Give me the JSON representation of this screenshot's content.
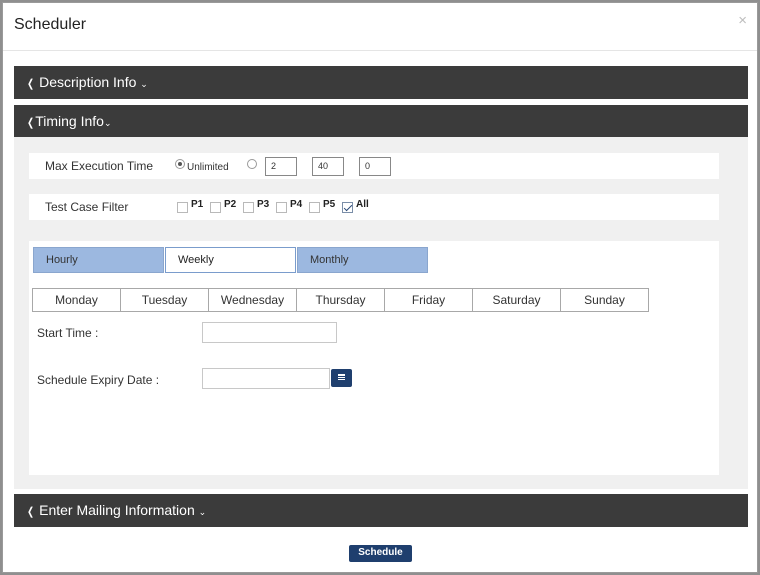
{
  "modal": {
    "title": "Scheduler",
    "close_glyph": "×"
  },
  "sections": {
    "description": {
      "label": "Description Info",
      "left_icon": "chevron-left-icon",
      "right_icon": "chevron-down-icon"
    },
    "timing": {
      "label": "Timing Info",
      "left_icon": "chevron-left-icon",
      "right_icon": "chevron-down-icon"
    },
    "mailing": {
      "label": "Enter Mailing Information",
      "left_icon": "chevron-left-icon",
      "right_icon": "chevron-down-icon"
    }
  },
  "max_execution": {
    "label": "Max Execution Time",
    "unlimited_label": "Unlimited",
    "unlimited_selected": true,
    "custom_selected": false,
    "hours": "2",
    "minutes": "40",
    "seconds": "0"
  },
  "test_case_filter": {
    "label": "Test Case Filter",
    "options": [
      {
        "label": "P1",
        "checked": false
      },
      {
        "label": "P2",
        "checked": false
      },
      {
        "label": "P3",
        "checked": false
      },
      {
        "label": "P4",
        "checked": false
      },
      {
        "label": "P5",
        "checked": false
      },
      {
        "label": "All",
        "checked": true
      }
    ]
  },
  "frequency_tabs": [
    {
      "label": "Hourly",
      "active": false
    },
    {
      "label": "Weekly",
      "active": true
    },
    {
      "label": "Monthly",
      "active": false
    }
  ],
  "days": [
    "Monday",
    "Tuesday",
    "Wednesday",
    "Thursday",
    "Friday",
    "Saturday",
    "Sunday"
  ],
  "start_time": {
    "label": "Start Time :",
    "value": ""
  },
  "expiry_date": {
    "label": "Schedule Expiry Date :",
    "value": "",
    "icon": "calendar-icon"
  },
  "footer": {
    "schedule_label": "Schedule"
  },
  "colors": {
    "section_bar": "#3b3b3b",
    "accent": "#1f3f6e",
    "tab_inactive": "#9cb8e0"
  }
}
